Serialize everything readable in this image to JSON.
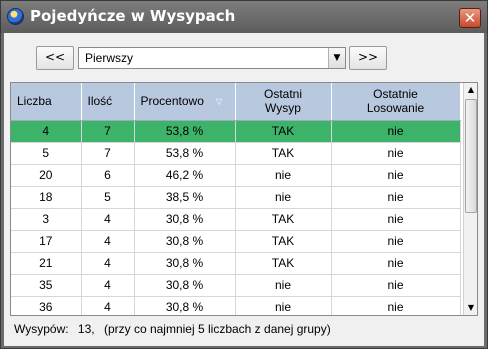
{
  "window": {
    "title": "Pojedyńcze w Wysypach",
    "close_glyph": "✕"
  },
  "nav": {
    "prev_label": "<<",
    "next_label": ">>",
    "group_value": "Pierwszy",
    "select_arrow": "▼"
  },
  "table": {
    "columns": [
      {
        "label": "Liczba"
      },
      {
        "label": "Ilość"
      },
      {
        "label": "Procentowo",
        "sort_icon": "▽"
      },
      {
        "label_line1": "Ostatni",
        "label_line2": "Wysyp"
      },
      {
        "label_line1": "Ostatnie",
        "label_line2": "Losowanie"
      }
    ],
    "rows": [
      {
        "liczba": "4",
        "ilosc": "7",
        "procent": "53,8 %",
        "wysyp": "TAK",
        "losowanie": "nie",
        "selected": true
      },
      {
        "liczba": "5",
        "ilosc": "7",
        "procent": "53,8 %",
        "wysyp": "TAK",
        "losowanie": "nie"
      },
      {
        "liczba": "20",
        "ilosc": "6",
        "procent": "46,2 %",
        "wysyp": "nie",
        "losowanie": "nie"
      },
      {
        "liczba": "18",
        "ilosc": "5",
        "procent": "38,5 %",
        "wysyp": "nie",
        "losowanie": "nie"
      },
      {
        "liczba": "3",
        "ilosc": "4",
        "procent": "30,8 %",
        "wysyp": "TAK",
        "losowanie": "nie"
      },
      {
        "liczba": "17",
        "ilosc": "4",
        "procent": "30,8 %",
        "wysyp": "TAK",
        "losowanie": "nie"
      },
      {
        "liczba": "21",
        "ilosc": "4",
        "procent": "30,8 %",
        "wysyp": "TAK",
        "losowanie": "nie"
      },
      {
        "liczba": "35",
        "ilosc": "4",
        "procent": "30,8 %",
        "wysyp": "nie",
        "losowanie": "nie"
      },
      {
        "liczba": "36",
        "ilosc": "4",
        "procent": "30,8 %",
        "wysyp": "nie",
        "losowanie": "nie"
      }
    ],
    "selected_color": "#3db36a",
    "header_color": "#b8c9df"
  },
  "scrollbar": {
    "up_glyph": "▲",
    "down_glyph": "▼"
  },
  "status": {
    "label": "Wysypów:",
    "count": "13,",
    "note": "(przy co najmniej 5 liczbach z danej grupy)"
  }
}
